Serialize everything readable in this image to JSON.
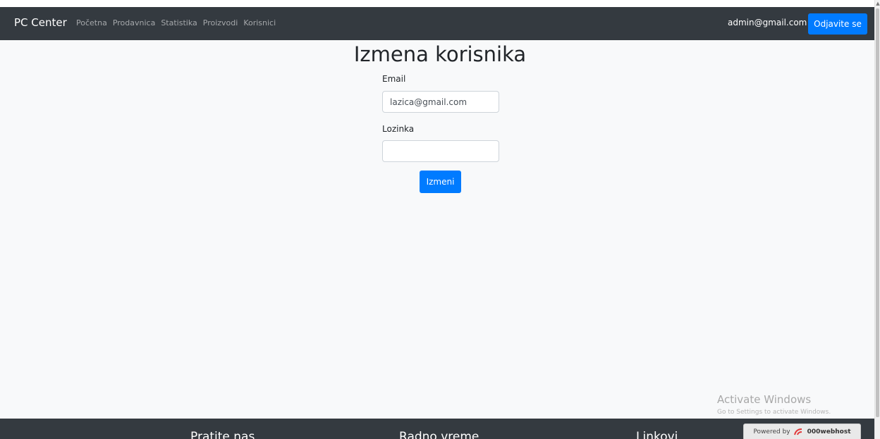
{
  "navbar": {
    "brand": "PC Center",
    "links": [
      "Početna",
      "Prodavnica",
      "Statistika",
      "Proizvodi",
      "Korisnici"
    ],
    "user_email": "admin@gmail.com",
    "logout_label": "Odjavite se"
  },
  "main": {
    "title": "Izmena korisnika",
    "email_label": "Email",
    "email_value": "lazica@gmail.com",
    "password_label": "Lozinka",
    "password_value": "",
    "submit_label": "Izmeni"
  },
  "watermark": {
    "title": "Activate Windows",
    "subtitle": "Go to Settings to activate Windows."
  },
  "footer": {
    "headings": [
      "Pratite nas",
      "Radno vreme",
      "Linkovi"
    ],
    "powered_prefix": "Powered by",
    "powered_brand": "000webhost"
  },
  "colors": {
    "navbar_bg": "#343a40",
    "primary": "#007bff",
    "page_bg": "#f8f9fa"
  }
}
